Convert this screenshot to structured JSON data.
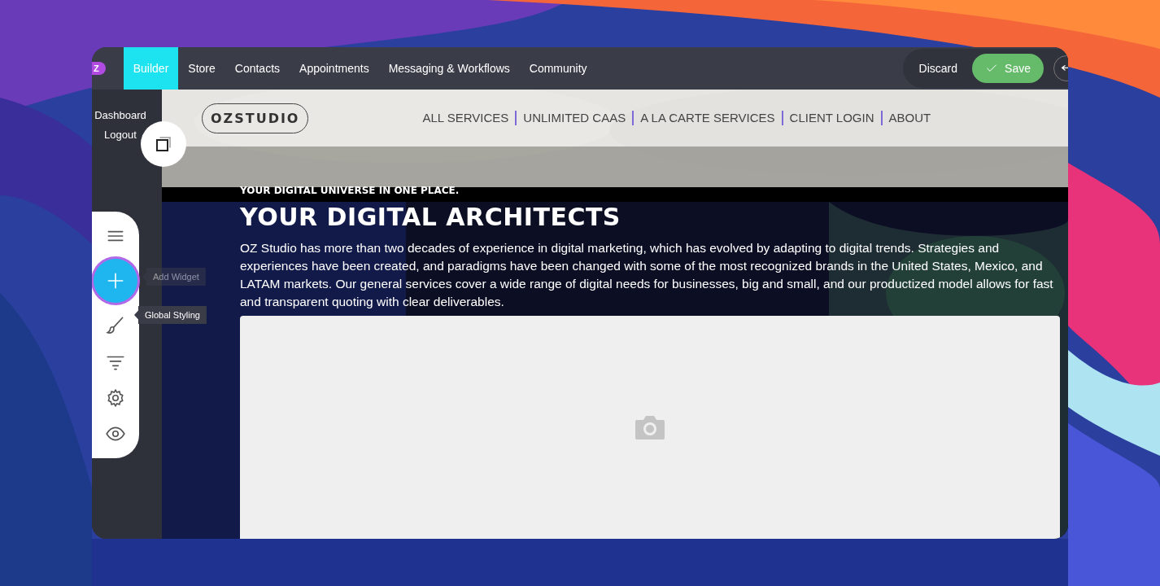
{
  "topbar": {
    "logo": "Z",
    "tabs": [
      {
        "label": "Builder",
        "selected": true
      },
      {
        "label": "Store",
        "selected": false
      },
      {
        "label": "Contacts",
        "selected": false
      },
      {
        "label": "Appointments",
        "selected": false
      },
      {
        "label": "Messaging & Workflows",
        "selected": false
      },
      {
        "label": "Community",
        "selected": false
      }
    ],
    "discard": "Discard",
    "save": "Save"
  },
  "sidebar": {
    "items": [
      "Dashboard",
      "Logout"
    ]
  },
  "toolbar": {
    "tools": [
      {
        "kind": "menu",
        "selected": false
      },
      {
        "kind": "add",
        "selected": true
      },
      {
        "kind": "brush",
        "selected": false
      },
      {
        "kind": "filter",
        "selected": false
      },
      {
        "kind": "settings",
        "selected": false
      },
      {
        "kind": "preview",
        "selected": false
      }
    ],
    "tooltips": [
      {
        "label": "Add Widget",
        "faded": true
      },
      {
        "label": "Global Styling",
        "faded": false
      }
    ]
  },
  "site": {
    "logo": "OZSTUDIO",
    "nav": [
      "ALL SERVICES",
      "UNLIMITED CAAS",
      "A LA CARTE SERVICES",
      "CLIENT LOGIN",
      "ABOUT"
    ],
    "tagline": "YOUR DIGITAL UNIVERSE IN ONE PLACE.",
    "heading": "YOUR DIGITAL ARCHITECTS",
    "paragraph": "OZ Studio has more than two decades of experience in digital marketing, which has evolved by adapting to digital trends. Strategies and experiences have been created, and paradigms have been changed with some of the most recognized brands in the United States, Mexico, and LATAM markets. Our general services cover a wide range of digital needs for businesses, big and small, and our productized model allows for fast and transparent quoting with clear deliverables."
  }
}
